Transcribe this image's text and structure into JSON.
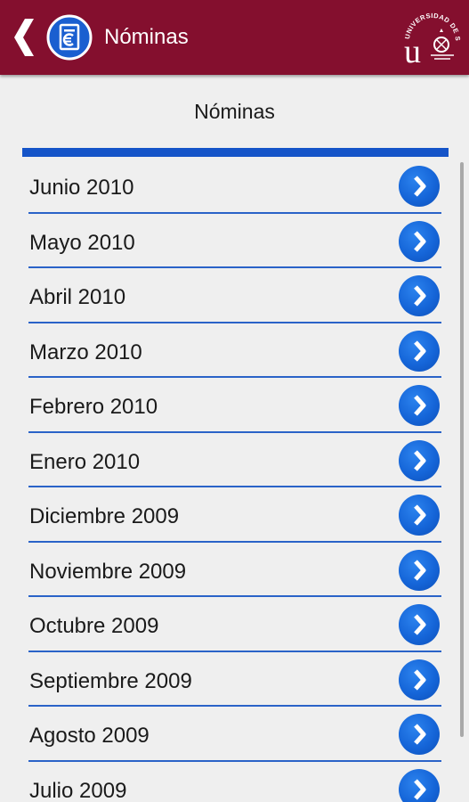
{
  "appbar": {
    "title": "Nóminas",
    "back_icon": "chevron-left-icon",
    "app_icon": "euro-document-icon",
    "logo": "universidad-de-sevilla-logo",
    "logo_text": "UNIVERSIDAD DE SEVILLA",
    "color": "#840f2e"
  },
  "section": {
    "title": "Nóminas",
    "accent": "#1554c8"
  },
  "list": {
    "item_icon": "chevron-right-icon",
    "items": [
      {
        "label": "Junio 2010"
      },
      {
        "label": "Mayo 2010"
      },
      {
        "label": "Abril 2010"
      },
      {
        "label": "Marzo 2010"
      },
      {
        "label": "Febrero 2010"
      },
      {
        "label": "Enero 2010"
      },
      {
        "label": "Diciembre 2009"
      },
      {
        "label": "Noviembre 2009"
      },
      {
        "label": "Octubre 2009"
      },
      {
        "label": "Septiembre 2009"
      },
      {
        "label": "Agosto 2009"
      },
      {
        "label": "Julio 2009"
      }
    ]
  }
}
